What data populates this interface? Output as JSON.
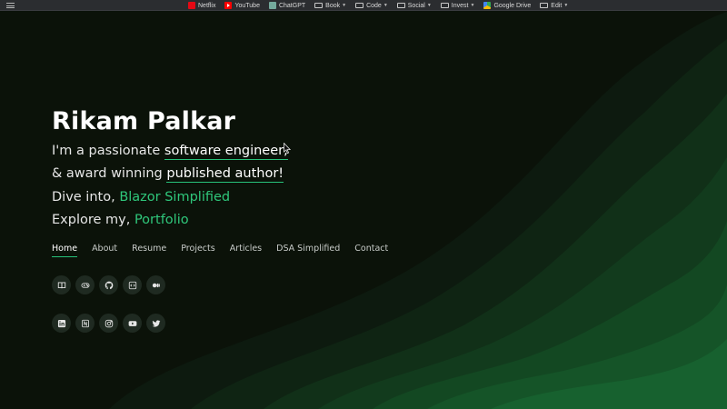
{
  "bookmarks": {
    "items": [
      {
        "label": "Netflix",
        "icon": "netflix-icon",
        "has_menu": false
      },
      {
        "label": "YouTube",
        "icon": "youtube-icon",
        "has_menu": false
      },
      {
        "label": "ChatGPT",
        "icon": "chatgpt-icon",
        "has_menu": false
      },
      {
        "label": "Book",
        "icon": "folder-icon",
        "has_menu": true
      },
      {
        "label": "Code",
        "icon": "folder-icon",
        "has_menu": true
      },
      {
        "label": "Social",
        "icon": "folder-icon",
        "has_menu": true
      },
      {
        "label": "Invest",
        "icon": "folder-icon",
        "has_menu": true
      },
      {
        "label": "Google Drive",
        "icon": "google-drive-icon",
        "has_menu": false
      },
      {
        "label": "Edit",
        "icon": "folder-icon",
        "has_menu": true
      }
    ]
  },
  "hero": {
    "name": "Rikam Palkar",
    "line1_prefix": "I'm a passionate ",
    "line1_highlight": "software engineer,",
    "line2_prefix": "& award winning ",
    "line2_highlight": "published author!",
    "line3_prefix": "Dive into, ",
    "line3_link": "Blazor Simplified",
    "line4_prefix": "Explore my, ",
    "line4_link": "Portfolio"
  },
  "nav": {
    "items": [
      "Home",
      "About",
      "Resume",
      "Projects",
      "Articles",
      "DSA Simplified",
      "Contact"
    ],
    "active": "Home"
  },
  "social_row1": [
    "book-icon",
    "gamepad-icon",
    "github-icon",
    "code-icon",
    "medium-icon"
  ],
  "social_row2": [
    "linkedin-icon",
    "notion-icon",
    "instagram-icon",
    "youtube-icon",
    "twitter-icon"
  ],
  "colors": {
    "accent": "#27c27a",
    "background": "#0b1209",
    "wave_dark": "#0e1b10",
    "wave_mid": "#124a23",
    "wave_light": "#17653a"
  }
}
